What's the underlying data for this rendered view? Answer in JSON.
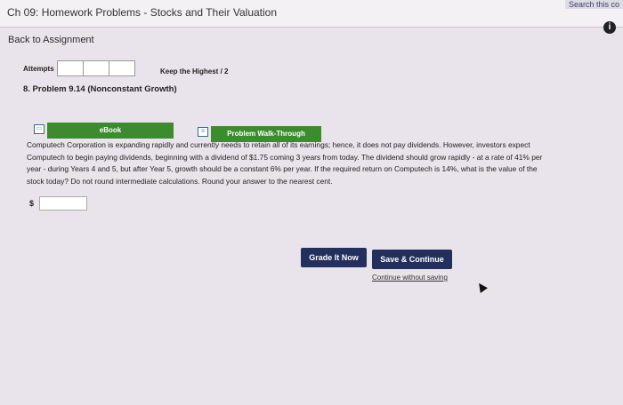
{
  "header": {
    "title": "Ch 09: Homework Problems - Stocks and Their Valuation",
    "search_text": "Search this co"
  },
  "nav": {
    "back": "Back to Assignment"
  },
  "attempts": {
    "label": "Attempts",
    "keep_highest": "Keep the Highest / 2"
  },
  "problem": {
    "title": "8. Problem 9.14 (Nonconstant Growth)"
  },
  "tools": {
    "ebook": "eBook",
    "walkthrough": "Problem Walk-Through"
  },
  "question": {
    "lines": [
      "Computech Corporation is expanding rapidly and currently needs to retain all of its earnings; hence, it does not pay dividends. However, investors expect",
      "Computech to begin paying dividends, beginning with a dividend of $1.75 coming 3 years from today. The dividend should grow rapidly - at a rate of 41% per",
      "year - during Years 4 and 5, but after Year 5, growth should be a constant 6% per year. If the required return on Computech is 14%, what is the value of the",
      "stock today? Do not round intermediate calculations. Round your answer to the nearest cent."
    ]
  },
  "answer": {
    "currency": "$",
    "value": ""
  },
  "buttons": {
    "grade": "Grade It Now",
    "save": "Save & Continue",
    "continue_without": "Continue without saving"
  },
  "colors": {
    "primary": "#23305e",
    "ebook_green": "#3d8b2f"
  }
}
